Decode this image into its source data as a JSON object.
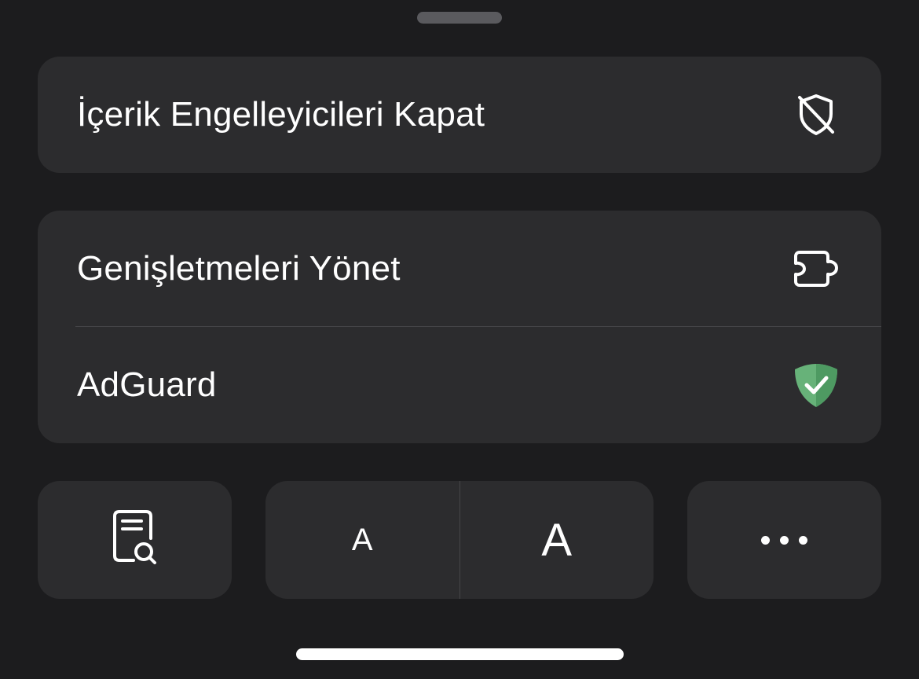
{
  "menu": {
    "disable_blockers": {
      "label": "İçerik Engelleyicileri Kapat",
      "icon": "shield-slash-icon"
    },
    "manage_extensions": {
      "label": "Genişletmeleri Yönet",
      "icon": "puzzle-piece-icon"
    },
    "adguard": {
      "label": "AdGuard",
      "icon": "adguard-shield-icon",
      "icon_color": "#67b279"
    }
  },
  "toolbar": {
    "reader_icon": "document-search-icon",
    "font_smaller_label": "A",
    "font_larger_label": "A",
    "more_icon": "ellipsis-icon"
  },
  "colors": {
    "background": "#1c1c1e",
    "surface": "#2c2c2e",
    "separator": "#454548",
    "text": "#ffffff"
  }
}
